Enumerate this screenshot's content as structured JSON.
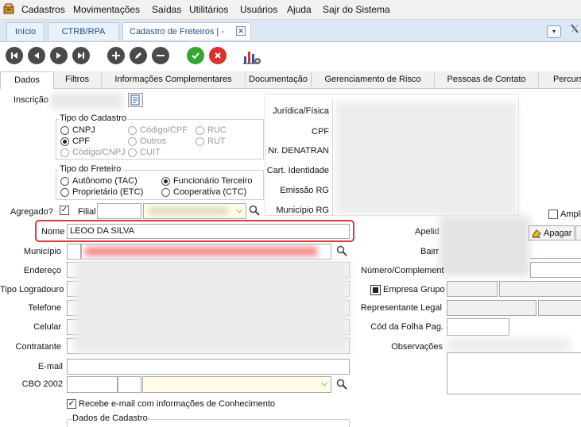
{
  "menu": {
    "items": [
      "Cadastros",
      "Movimentações",
      "Saídas",
      "Utilitários",
      "Usuários",
      "Ajuda",
      "Sajr do Sistema"
    ]
  },
  "tabs": {
    "items": [
      "Início",
      "CTRB/RPA",
      "Cadastro de Freteiros | -"
    ]
  },
  "form_tabs": [
    "Dados",
    "Filtros",
    "Informações Complementares",
    "Documentação",
    "Gerenciamento de Risco",
    "Pessoas de Contato",
    "Percurs"
  ],
  "form": {
    "inscricao_label": "Inscrição",
    "tipo_cadastro": {
      "title": "Tipo do Cadastro",
      "options": [
        "CNPJ",
        "Código/CPF",
        "RUC",
        "CPF",
        "Outros",
        "RUT",
        "Código/CNPJ",
        "CUIT"
      ]
    },
    "tipo_freteiro": {
      "title": "Tipo do Freteiro",
      "options": [
        "Autônomo (TAC)",
        "Funcionário Terceiro",
        "Proprietário (ETC)",
        "Cooperativa (CTC)"
      ]
    },
    "right_labels": [
      "Jurídica/Física",
      "CPF",
      "Nr. DENATRAN",
      "Cart. Identidade",
      "Emissão RG",
      "Município RG"
    ],
    "agregado_label": "Agregado?",
    "filial_label": "Filial",
    "ampli_label": "Ampli",
    "nome_label": "Nome",
    "nome_value": "LEOO DA SILVA",
    "apelido_label": "Apelid",
    "apagar_label": "Apagar",
    "municipio_label": "Município",
    "bairro_label": "Bairr",
    "endereco_label": "Endereço",
    "numero_label": "Número/Complement",
    "tipo_logradouro_label": "Tipo Logradouro",
    "empresa_grupo_label": "Empresa Grupo",
    "telefone_label": "Telefone",
    "representante_label": "Representante Legal",
    "celular_label": "Celular",
    "cod_folha_label": "Cód da Folha Pag.",
    "contratante_label": "Contratante",
    "observacoes_label": "Observações",
    "email_label": "E-mail",
    "cbo_label": "CBO 2002",
    "recebe_email_label": "Recebe e-mail com informações de Conhecimento",
    "dados_cadastro_label": "Dados de Cadastro"
  }
}
